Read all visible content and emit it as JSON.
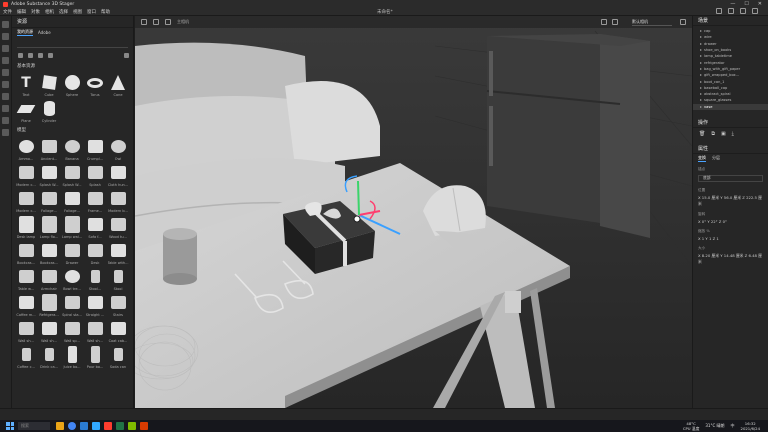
{
  "window": {
    "title": "Adobe Substance 3D Stager",
    "doc_title": "未命名*"
  },
  "menu": [
    "文件",
    "编辑",
    "对象",
    "相机",
    "选择",
    "视图",
    "窗口",
    "帮助"
  ],
  "assets": {
    "title": "资源",
    "tabs": [
      "我的资源",
      "Adobe"
    ],
    "basic_title": "基本资源",
    "basic": [
      "Text",
      "Cube",
      "Sphere",
      "Torus",
      "Cone",
      "Plane",
      "Cylinder"
    ],
    "models_title": "模型",
    "models": [
      "Ammo...",
      "Ancient...",
      "Banana",
      "Crumpl...",
      "Owl",
      "Modern c...",
      "Splash W...",
      "Splash W...",
      "Splash",
      "Cloth hun...",
      "Modern c...",
      "Foliage...",
      "Foliage...",
      "Frame...",
      "Modern b...",
      "Desk lamp",
      "Lamp flo...",
      "Lamp wal...",
      "Sofa f...",
      "Wood tu...",
      "Bookcas...",
      "Bookcas...",
      "Drawer",
      "Desk",
      "Table with...",
      "Table w...",
      "Armchair",
      "Bowl tre...",
      "Stool...",
      "Stool",
      "Coffee m...",
      "Refrigera...",
      "Spiral sta...",
      "Straight ...",
      "Stairs",
      "Wall sh...",
      "Wall sh...",
      "Wall sp...",
      "Wall sh...",
      "Coat cab...",
      "Coffee c...",
      "Drink ca...",
      "Juice bo...",
      "Pour bo...",
      "Soda can"
    ]
  },
  "viewport": {
    "camera_label": "主相机",
    "camera_select": "默认相机"
  },
  "outline": {
    "title": "场景",
    "items": [
      "cap",
      "wire",
      "drawer",
      "shoe_on_books",
      "lamp_tabletime",
      "refrigerator",
      "bag_with_gift_paper",
      "gift_wrapped_box...",
      "boot_can_1",
      "baseball_cap",
      "abstract_spiral",
      "square_glasses",
      "vase"
    ],
    "selected_index": 12
  },
  "actions": {
    "title": "操作"
  },
  "properties": {
    "title": "属性",
    "tabs": [
      "变换",
      "分层"
    ],
    "anchor_label": "锚点",
    "anchor_value": "底部",
    "position_label": "位置",
    "position": "X 15.0 厘米  Y 56.0 厘米  Z 222.5 厘米",
    "rotation_label": "旋转",
    "rotation": "X 0°   Y 22°   Z 0°",
    "scale_label": "缩放 %",
    "scale": "X 1    Y 1    Z 1",
    "size_label": "大小",
    "size": "X 8.20 厘米  Y 14.48 厘米  Z 6.48 厘米"
  },
  "taskbar": {
    "search": "搜索",
    "temperature": "48°C",
    "cpu": "CPU 温度",
    "weather": "31°C 晴朗",
    "time": "16:32",
    "date": "2021/6/24",
    "lang": "中"
  }
}
